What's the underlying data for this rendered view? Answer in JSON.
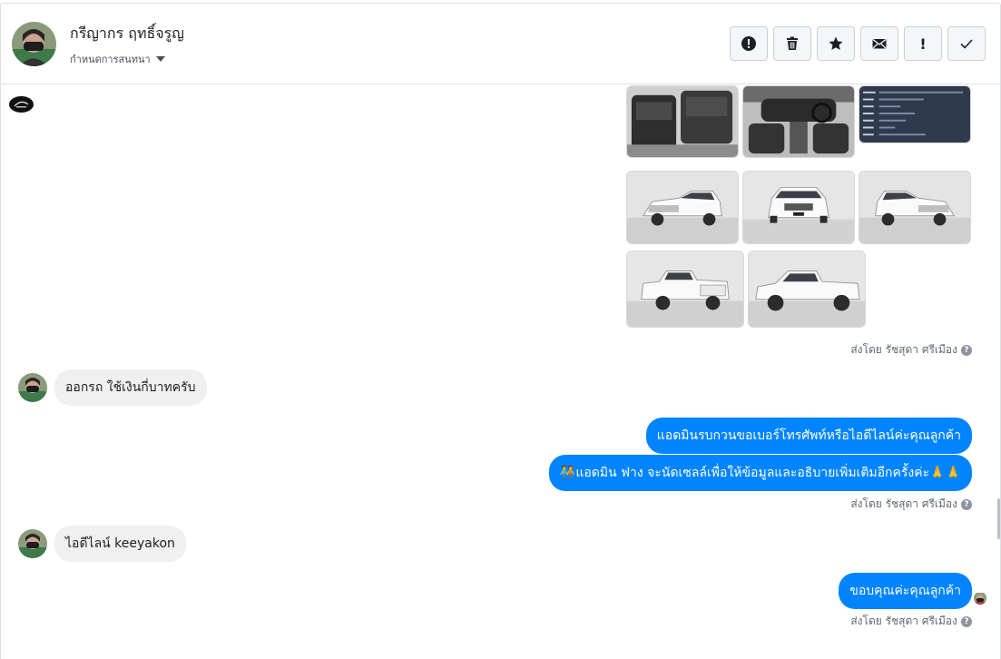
{
  "header": {
    "name": "กรีญากร ฤทธิ์จรูญ",
    "subtitle": "กำหนดการสนทนา",
    "actions": [
      {
        "name": "report-spam-button",
        "icon": "alert-circle-icon"
      },
      {
        "name": "delete-button",
        "icon": "trash-icon"
      },
      {
        "name": "star-button",
        "icon": "star-icon"
      },
      {
        "name": "mark-unread-button",
        "icon": "envelope-icon"
      },
      {
        "name": "mark-priority-button",
        "icon": "exclamation-icon"
      },
      {
        "name": "mark-done-button",
        "icon": "check-icon"
      }
    ]
  },
  "messages": {
    "sent_by_1": "ส่งโดย รัชสุดา ศรีเมือง",
    "incoming_1": "ออกรถ ใช้เงินกี่บาทครับ",
    "outgoing_1": "แอดมินรบกวนขอเบอร์โทรศัพท์หรือไอดีไลน์ค่ะคุณลูกค้า",
    "outgoing_2": "🧑‍🤝‍🧑แอดมิน ฟาง จะนัดเซลล์เพื่อให้ข้อมูลและอธิบายเพิ่มเติมอีกครั้งค่ะ🙏🙏",
    "sent_by_2": "ส่งโดย รัชสุดา ศรีเมือง",
    "incoming_2": "ไอดีไลน์ keeyakon",
    "outgoing_3": "ขอบคุณค่ะคุณลูกค้า",
    "sent_by_3": "ส่งโดย รัชสุดา ศรีเมือง",
    "info_symbol": "?"
  },
  "colors": {
    "accent": "#0084ff",
    "incoming_bubble": "#f1f0f0",
    "border": "#dddfe2"
  }
}
